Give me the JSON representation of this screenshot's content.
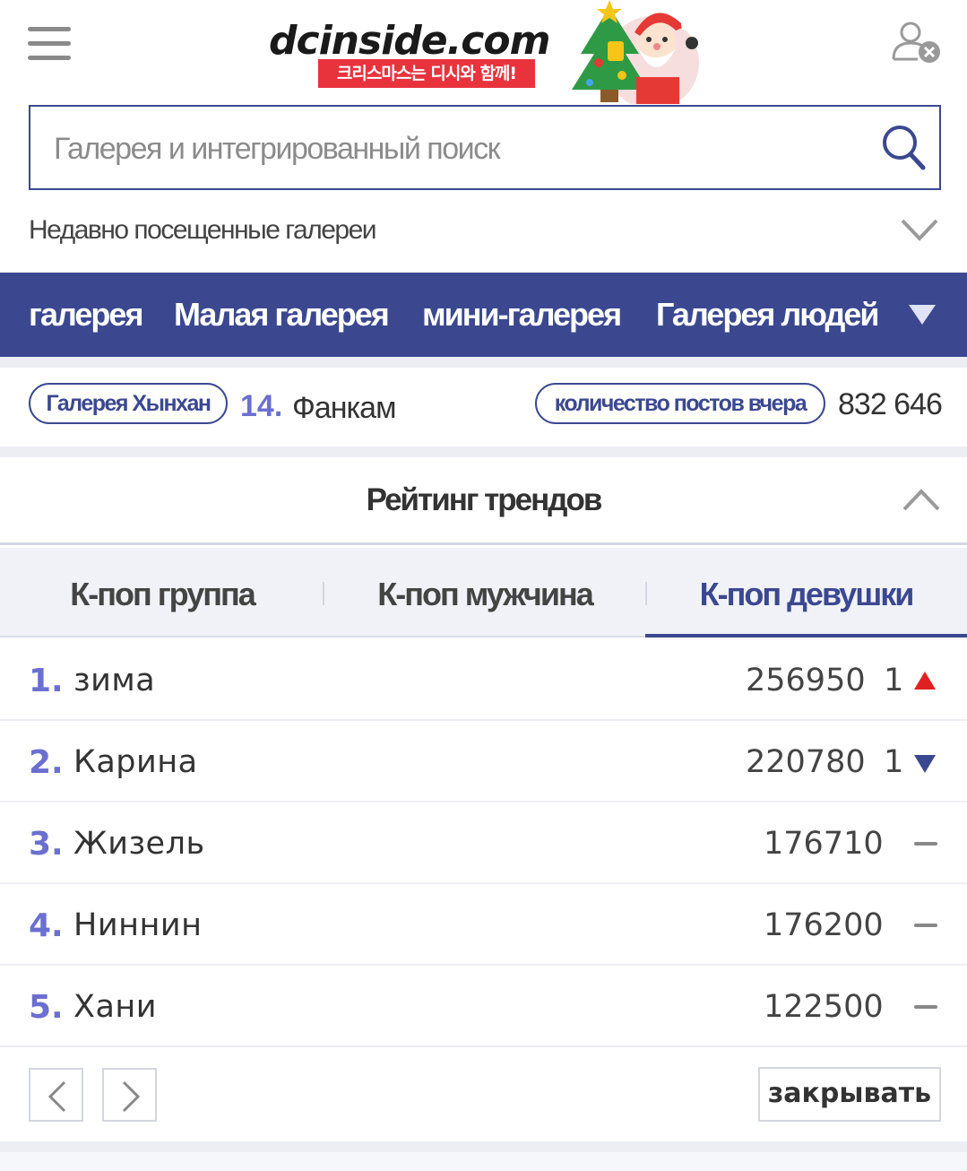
{
  "header": {
    "logo_text": "dcinside.com",
    "banner_text": "크리스마스는 디시와 함께!"
  },
  "search": {
    "placeholder": "Галерея и интегрированный поиск"
  },
  "recent": {
    "label": "Недавно посещенные галереи"
  },
  "nav": {
    "items": [
      "галерея",
      "Малая галерея",
      "мини-галерея",
      "Галерея людей"
    ]
  },
  "info": {
    "gallery_pill": "Галерея Хынхан",
    "rank_num": "14.",
    "rank_name": "Фанкам",
    "posts_pill": "количество постов вчера",
    "post_count": "832 646"
  },
  "trend": {
    "title": "Рейтинг трендов",
    "tabs": [
      "К-поп группа",
      "К-поп мужчина",
      "К-поп девушки"
    ],
    "active_tab": 2,
    "rows": [
      {
        "num": "1.",
        "name": "зима",
        "value": "256950",
        "delta": "1",
        "trend": "up"
      },
      {
        "num": "2.",
        "name": "Карина",
        "value": "220780",
        "delta": "1",
        "trend": "down"
      },
      {
        "num": "3.",
        "name": "Жизель",
        "value": "176710",
        "delta": "",
        "trend": "same"
      },
      {
        "num": "4.",
        "name": "Ниннин",
        "value": "176200",
        "delta": "",
        "trend": "same"
      },
      {
        "num": "5.",
        "name": "Хани",
        "value": "122500",
        "delta": "",
        "trend": "same"
      }
    ]
  },
  "footer": {
    "close_label": "закрывать"
  },
  "colors": {
    "brand": "#3b4890",
    "rank_number": "#6b6fd0",
    "trend_up": "#e02020",
    "trend_down": "#3b4890"
  }
}
